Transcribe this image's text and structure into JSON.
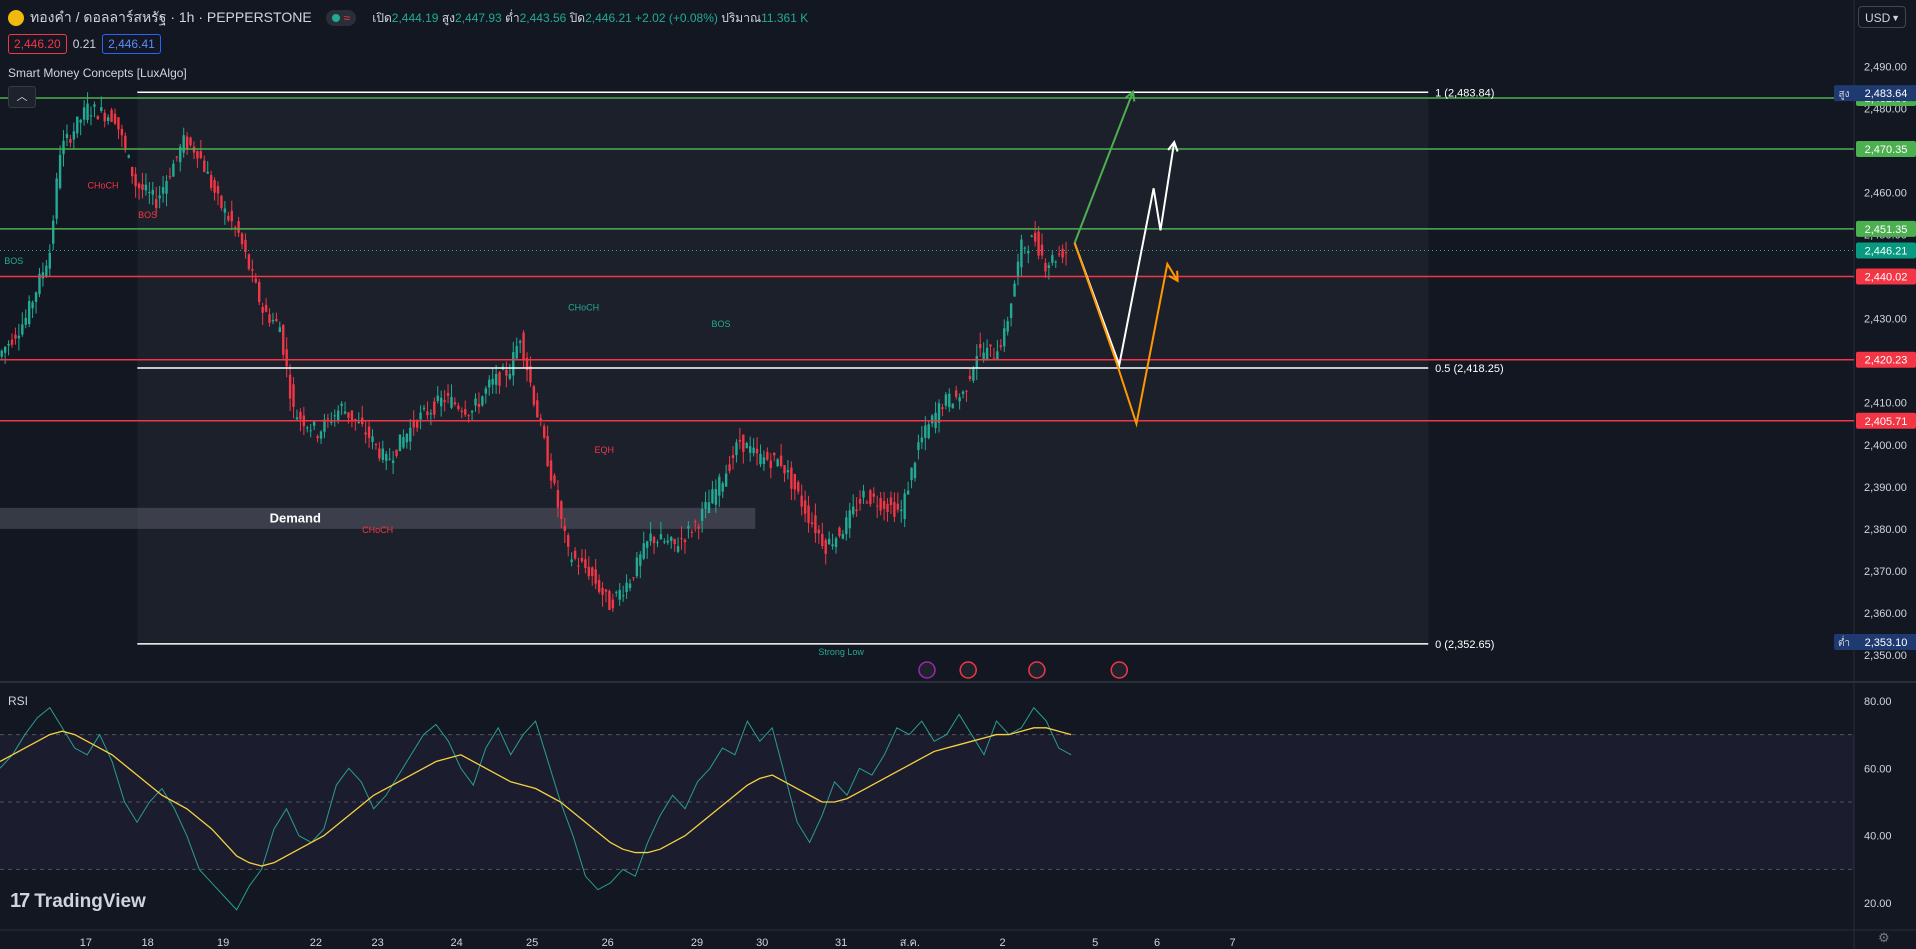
{
  "header": {
    "symbol": "ทองคำ / ดอลลาร์สหรัฐ · 1h · PEPPERSTONE",
    "open_label": "เปิด",
    "open": "2,444.19",
    "high_label": "สูง",
    "high": "2,447.93",
    "low_label": "ต่ำ",
    "low": "2,443.56",
    "close_label": "ปิด",
    "close": "2,446.21",
    "change": "+2.02 (+0.08%)",
    "volume_label": "ปริมาณ",
    "volume": "11.361 K",
    "currency": "USD"
  },
  "quote": {
    "bid": "2,446.20",
    "spread": "0.21",
    "ask": "2,446.41"
  },
  "indicator_name": "Smart Money Concepts [LuxAlgo]",
  "rsi_label": "RSI",
  "brand": "TradingView",
  "colors": {
    "bg": "#131722",
    "up": "#22ab94",
    "down": "#f23645",
    "green_level": "#4caf50",
    "orange": "#ff9800",
    "rsi_line": "#2a9d8f",
    "rsi_ma": "#f5d142"
  },
  "chart_data": [
    {
      "type": "candlestick",
      "title": "",
      "x_ticks": [
        "17",
        "18",
        "19",
        "22",
        "23",
        "24",
        "25",
        "26",
        "29",
        "30",
        "31",
        "ส.ค.",
        "2",
        "5",
        "6",
        "7"
      ],
      "y_ticks": [
        "2,490.00",
        "2,480.00",
        "2,470.00",
        "2,460.00",
        "2,450.00",
        "2,440.00",
        "2,430.00",
        "2,420.00",
        "2,410.00",
        "2,400.00",
        "2,390.00",
        "2,380.00",
        "2,370.00",
        "2,360.00",
        "2,350.00"
      ],
      "ylim": [
        2350,
        2492
      ],
      "path": [
        [
          0,
          2421
        ],
        [
          8,
          2430
        ],
        [
          15,
          2446
        ],
        [
          18,
          2470
        ],
        [
          26,
          2480
        ],
        [
          34,
          2478
        ],
        [
          40,
          2462
        ],
        [
          46,
          2458
        ],
        [
          54,
          2472
        ],
        [
          58,
          2470
        ],
        [
          64,
          2458
        ],
        [
          70,
          2450
        ],
        [
          77,
          2432
        ],
        [
          82,
          2428
        ],
        [
          86,
          2408
        ],
        [
          93,
          2403
        ],
        [
          100,
          2409
        ],
        [
          108,
          2402
        ],
        [
          113,
          2396
        ],
        [
          122,
          2406
        ],
        [
          130,
          2411
        ],
        [
          138,
          2408
        ],
        [
          143,
          2414
        ],
        [
          149,
          2418
        ],
        [
          152,
          2426
        ],
        [
          156,
          2411
        ],
        [
          161,
          2393
        ],
        [
          166,
          2374
        ],
        [
          172,
          2370
        ],
        [
          178,
          2362
        ],
        [
          184,
          2368
        ],
        [
          190,
          2378
        ],
        [
          197,
          2376
        ],
        [
          204,
          2382
        ],
        [
          211,
          2392
        ],
        [
          216,
          2401
        ],
        [
          221,
          2397
        ],
        [
          228,
          2396
        ],
        [
          236,
          2383
        ],
        [
          241,
          2376
        ],
        [
          246,
          2380
        ],
        [
          252,
          2388
        ],
        [
          258,
          2386
        ],
        [
          263,
          2384
        ],
        [
          268,
          2400
        ],
        [
          275,
          2410
        ],
        [
          281,
          2412
        ],
        [
          285,
          2422
        ],
        [
          290,
          2422
        ],
        [
          293,
          2426
        ],
        [
          298,
          2447
        ],
        [
          302,
          2449
        ],
        [
          305,
          2443
        ],
        [
          310,
          2446
        ]
      ],
      "fib_levels": [
        {
          "label": "1 (2,483.84)",
          "value": 2483.84
        },
        {
          "label": "0.5 (2,418.25)",
          "value": 2418.25
        },
        {
          "label": "0 (2,352.65)",
          "value": 2352.65
        }
      ],
      "green_levels": [
        {
          "price": "2,482.50",
          "value": 2482.5
        },
        {
          "price": "2,470.35",
          "value": 2470.35
        },
        {
          "price": "2,451.35",
          "value": 2451.35
        }
      ],
      "red_levels": [
        {
          "price": "2,440.02",
          "value": 2440.02
        },
        {
          "price": "2,420.23",
          "value": 2420.23
        },
        {
          "price": "2,405.71",
          "value": 2405.71
        }
      ],
      "current_price": {
        "price": "2,446.21",
        "value": 2446.21
      },
      "high_marker": {
        "label": "สูง",
        "price": "2,483.64",
        "value": 2483.64
      },
      "low_marker": {
        "label": "ต่ำ",
        "price": "2,353.10",
        "value": 2353.1
      },
      "zones": [
        {
          "label": "Demand",
          "from": 2380,
          "to": 2385
        }
      ],
      "annotations": [
        {
          "text": "CHoCH",
          "bar": 170,
          "price": 2432,
          "color": "#22ab94"
        },
        {
          "text": "CHoCH",
          "bar": 110,
          "price": 2379,
          "color": "#f23645"
        },
        {
          "text": "BOS",
          "bar": 4,
          "price": 2443,
          "color": "#22ab94"
        },
        {
          "text": "BOS",
          "bar": 43,
          "price": 2454,
          "color": "#f23645"
        },
        {
          "text": "CHoCH",
          "bar": 30,
          "price": 2461,
          "color": "#f23645"
        },
        {
          "text": "EQH",
          "bar": 176,
          "price": 2398,
          "color": "#f23645"
        },
        {
          "text": "BOS",
          "bar": 210,
          "price": 2428,
          "color": "#22ab94"
        },
        {
          "text": "Strong Low",
          "bar": 245,
          "price": 2350,
          "color": "#22ab94"
        }
      ],
      "scenarios": [
        {
          "color": "#4caf50",
          "points": [
            [
              313,
              2448
            ],
            [
              330,
              2484
            ]
          ]
        },
        {
          "color": "#ffffff",
          "points": [
            [
              313,
              2448
            ],
            [
              326,
              2419
            ],
            [
              336,
              2461
            ],
            [
              338,
              2451
            ],
            [
              342,
              2472
            ]
          ]
        },
        {
          "color": "#ff9800",
          "points": [
            [
              313,
              2448
            ],
            [
              325,
              2420
            ],
            [
              331,
              2405
            ],
            [
              340,
              2443
            ],
            [
              343,
              2439
            ]
          ]
        }
      ]
    },
    {
      "type": "line",
      "title": "",
      "y_ticks": [
        "80.00",
        "60.00",
        "40.00",
        "20.00"
      ],
      "ylim": [
        15,
        85
      ],
      "bands": [
        30,
        50,
        70
      ],
      "series": [
        {
          "color": "#2a9d8f",
          "values": [
            60,
            64,
            70,
            75,
            78,
            72,
            66,
            64,
            70,
            62,
            50,
            44,
            50,
            54,
            48,
            40,
            30,
            26,
            22,
            18,
            25,
            30,
            42,
            48,
            40,
            38,
            42,
            55,
            60,
            56,
            48,
            52,
            58,
            64,
            70,
            73,
            68,
            60,
            55,
            66,
            72,
            64,
            70,
            74,
            62,
            50,
            40,
            28,
            24,
            26,
            30,
            28,
            38,
            46,
            52,
            48,
            56,
            60,
            66,
            64,
            74,
            68,
            72,
            58,
            44,
            38,
            46,
            56,
            52,
            60,
            58,
            64,
            72,
            70,
            74,
            68,
            70,
            76,
            70,
            64,
            74,
            70,
            72,
            78,
            74,
            66,
            64
          ]
        },
        {
          "color": "#f5d142",
          "values": [
            62,
            64,
            66,
            68,
            70,
            71,
            70,
            68,
            66,
            64,
            61,
            58,
            55,
            52,
            50,
            48,
            45,
            42,
            38,
            34,
            32,
            31,
            32,
            34,
            36,
            38,
            40,
            43,
            46,
            49,
            52,
            54,
            56,
            58,
            60,
            62,
            63,
            64,
            62,
            60,
            58,
            56,
            55,
            54,
            52,
            50,
            47,
            44,
            41,
            38,
            36,
            35,
            35,
            36,
            38,
            40,
            43,
            46,
            49,
            52,
            55,
            57,
            58,
            56,
            54,
            52,
            50,
            50,
            51,
            53,
            55,
            57,
            59,
            61,
            63,
            65,
            66,
            67,
            68,
            69,
            70,
            70,
            71,
            72,
            72,
            71,
            70
          ]
        }
      ]
    }
  ]
}
